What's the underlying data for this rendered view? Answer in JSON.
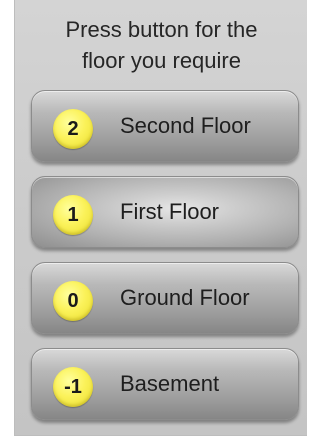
{
  "prompt": {
    "line1": "Press button for the",
    "line2": "floor you require"
  },
  "floors": [
    {
      "number": "2",
      "label": "Second Floor"
    },
    {
      "number": "1",
      "label": "First Floor"
    },
    {
      "number": "0",
      "label": "Ground Floor"
    },
    {
      "number": "-1",
      "label": "Basement"
    }
  ],
  "colors": {
    "panel": "#cbcbcb",
    "badge": "#fbf25a",
    "text": "#262626"
  }
}
